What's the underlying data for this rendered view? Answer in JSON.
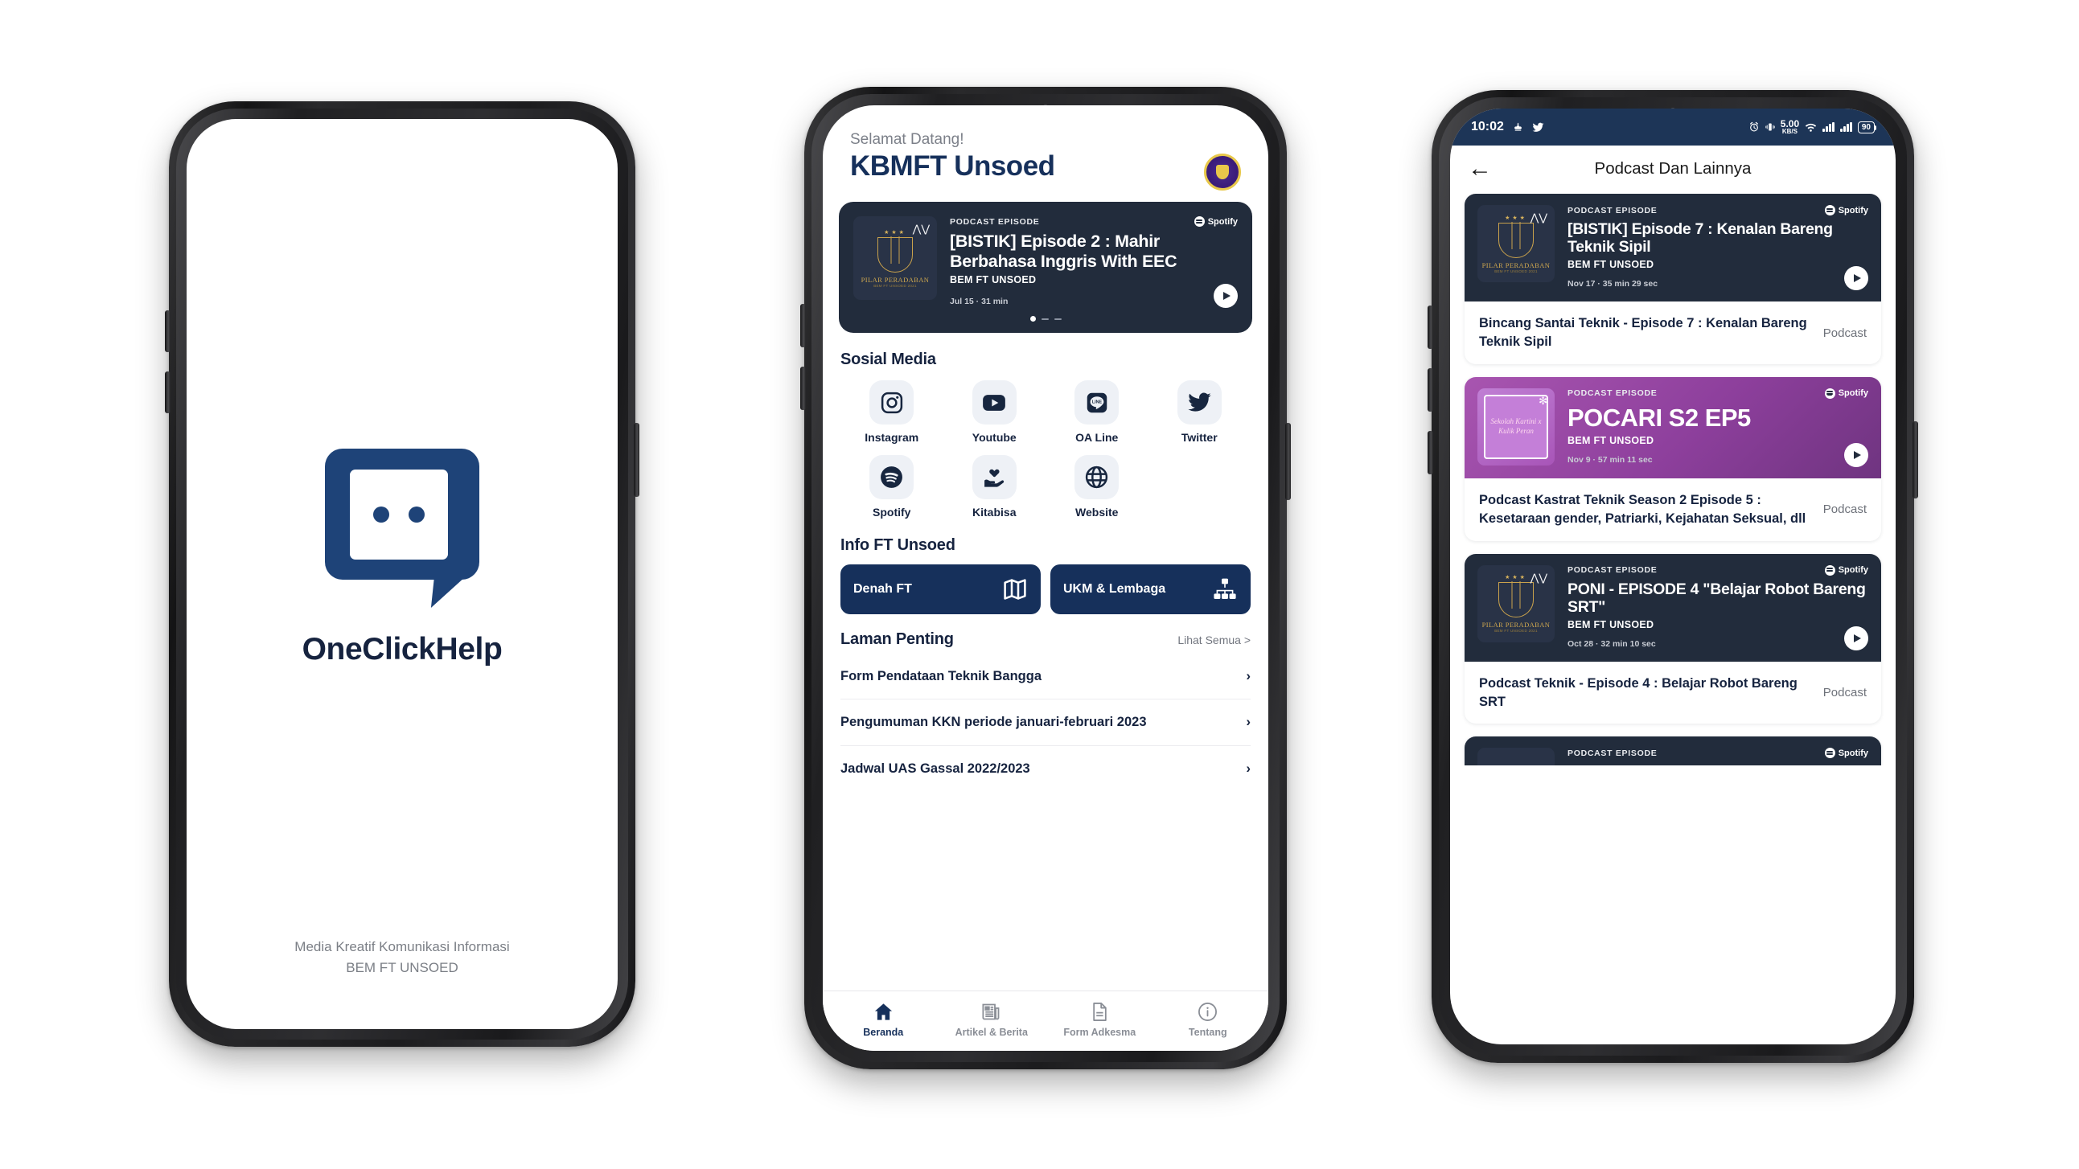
{
  "splash": {
    "app_name": "OneClickHelp",
    "logo_icon": "chat-bubble-logo",
    "footer_line1": "Media Kreatif Komunikasi Informasi",
    "footer_line2": "BEM FT UNSOED"
  },
  "home": {
    "welcome": "Selamat Datang!",
    "brand": "KBMFT Unsoed",
    "university_logo_icon": "unsoed-crest-icon",
    "hero": {
      "kicker": "PODCAST EPISODE",
      "platform": "Spotify",
      "title": "[BISTIK] Episode 2 : Mahir Berbahasa Inggris With EEC",
      "author": "BEM FT UNSOED",
      "date": "Jul 15 · 31 min",
      "art_title": "PILAR PERADABAN",
      "art_sub": "BEM FT UNSOED 2021",
      "play_icon": "play-icon",
      "carousel_dots": 3,
      "carousel_active": 1
    },
    "social_title": "Sosial Media",
    "socials": [
      {
        "label": "Instagram",
        "icon": "instagram-icon"
      },
      {
        "label": "Youtube",
        "icon": "youtube-icon"
      },
      {
        "label": "OA Line",
        "icon": "line-icon"
      },
      {
        "label": "Twitter",
        "icon": "twitter-icon"
      },
      {
        "label": "Spotify",
        "icon": "spotify-icon"
      },
      {
        "label": "Kitabisa",
        "icon": "hand-heart-icon"
      },
      {
        "label": "Website",
        "icon": "globe-icon"
      }
    ],
    "info_title": "Info FT Unsoed",
    "info_buttons": [
      {
        "label": "Denah FT",
        "icon": "map-icon"
      },
      {
        "label": "UKM & Lembaga",
        "icon": "org-chart-icon"
      }
    ],
    "laman_title": "Laman Penting",
    "see_all": "Lihat Semua >",
    "laman_items": [
      "Form Pendataan Teknik Bangga",
      "Pengumuman KKN periode januari-februari 2023",
      "Jadwal UAS Gassal 2022/2023"
    ],
    "tabs": [
      {
        "label": "Beranda",
        "icon": "home-icon",
        "active": true
      },
      {
        "label": "Artikel & Berita",
        "icon": "newspaper-icon",
        "active": false
      },
      {
        "label": "Form Adkesma",
        "icon": "document-icon",
        "active": false
      },
      {
        "label": "Tentang",
        "icon": "info-circle-icon",
        "active": false
      }
    ]
  },
  "podcast_page": {
    "statusbar": {
      "time": "10:02",
      "left_icons": [
        "cnbc-icon",
        "twitter-icon"
      ],
      "right_icons": [
        "alarm-icon",
        "vibrate-icon"
      ],
      "network_speed_value": "5.00",
      "network_speed_unit": "KB/S",
      "wifi_icon": "wifi-icon",
      "signal_icon": "signal-bars-icon",
      "battery": "90"
    },
    "back_icon": "back-arrow-icon",
    "title": "Podcast Dan Lainnya",
    "cards": [
      {
        "theme": "dark",
        "kicker": "PODCAST EPISODE",
        "platform": "Spotify",
        "title": "[BISTIK] Episode 7 : Kenalan Bareng Teknik Sipil",
        "author": "BEM FT UNSOED",
        "date": "Nov 17 · 35 min 29 sec",
        "art_title": "PILAR PERADABAN",
        "art_sub": "BEM FT UNSOED 2021",
        "art_kind": "pilar",
        "foot_title": "Bincang Santai Teknik - Episode 7 : Kenalan Bareng Teknik Sipil",
        "foot_tag": "Podcast"
      },
      {
        "theme": "purple",
        "kicker": "PODCAST EPISODE",
        "platform": "Spotify",
        "title": "POCARI S2 EP5",
        "author": "BEM FT UNSOED",
        "date": "Nov 9 · 57 min 11 sec",
        "art_title": "Sekolah Kartini x Kulik Peran",
        "art_sub": "",
        "art_kind": "poster",
        "foot_title": "Podcast Kastrat Teknik Season 2 Episode 5 : Kesetaraan gender, Patriarki, Kejahatan Seksual, dll",
        "foot_tag": "Podcast"
      },
      {
        "theme": "dark",
        "kicker": "PODCAST EPISODE",
        "platform": "Spotify",
        "title": "PONI - EPISODE 4 \"Belajar Robot Bareng SRT\"",
        "author": "BEM FT UNSOED",
        "date": "Oct 28 · 32 min 10 sec",
        "art_title": "PILAR PERADABAN",
        "art_sub": "BEM FT UNSOED 2021",
        "art_kind": "pilar",
        "foot_title": "Podcast Teknik - Episode 4 : Belajar Robot Bareng SRT",
        "foot_tag": "Podcast"
      },
      {
        "theme": "dark",
        "kicker": "PODCAST EPISODE",
        "platform": "Spotify",
        "title": "",
        "author": "",
        "date": "",
        "art_title": "",
        "art_sub": "",
        "art_kind": "pilar",
        "foot_title": "",
        "foot_tag": ""
      }
    ]
  },
  "colors": {
    "brand_navy": "#16305b",
    "card_dark": "#222c3c",
    "card_purple": "#8d3f9c",
    "statusbar": "#1d3557",
    "logo_blue": "#1e4378",
    "tile_grey": "#eef1f6"
  }
}
